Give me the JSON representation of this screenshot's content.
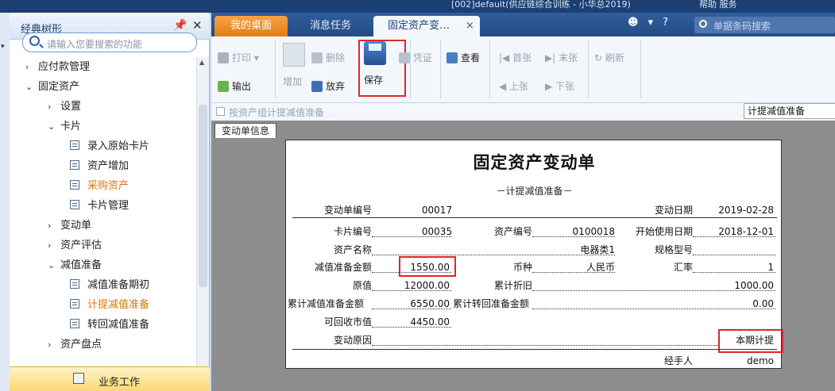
{
  "window": {
    "title_fragment": "[002]default(供应链综合训练 - 小华总2019)",
    "right_fragment": "帮助   服务"
  },
  "left_panel": {
    "title": "经典树形",
    "search_placeholder": "请输入您要搜索的功能",
    "tree": [
      {
        "label": "应付款管理",
        "chev": "›",
        "level": 1
      },
      {
        "label": "固定资产",
        "chev": "⌄",
        "level": 1
      },
      {
        "label": "设置",
        "chev": "›",
        "level": 2
      },
      {
        "label": "卡片",
        "chev": "⌄",
        "level": 2
      },
      {
        "label": "录入原始卡片",
        "level": 3
      },
      {
        "label": "资产增加",
        "level": 3
      },
      {
        "label": "采购资产",
        "level": 3,
        "highlight": true
      },
      {
        "label": "卡片管理",
        "level": 3
      },
      {
        "label": "变动单",
        "chev": "›",
        "level": 2
      },
      {
        "label": "资产评估",
        "chev": "›",
        "level": 2
      },
      {
        "label": "减值准备",
        "chev": "⌄",
        "level": 2
      },
      {
        "label": "减值准备期初",
        "level": 3
      },
      {
        "label": "计提减值准备",
        "level": 3,
        "highlight": true
      },
      {
        "label": "转回减值准备",
        "level": 3
      },
      {
        "label": "资产盘点",
        "chev": "›",
        "level": 2
      }
    ],
    "bottom_label": "业务工作"
  },
  "tabs": {
    "desk": "我的桌面",
    "msg": "消息任务",
    "active": "固定资产变…",
    "close": "×",
    "search_placeholder": "单据条码搜索"
  },
  "toolbar": {
    "print": "打印",
    "export": "输出",
    "add": "增加",
    "delete": "删除",
    "abandon": "放弃",
    "save": "保存",
    "voucher": "凭证",
    "view": "查看",
    "first": "首张",
    "last": "末张",
    "prev": "上张",
    "next": "下张",
    "refresh": "刷新"
  },
  "filter": {
    "checkbox_label": "按资产组计提减值准备",
    "combo_value": "计提减值准备"
  },
  "subtab": "变动单信息",
  "form": {
    "title": "固定资产变动单",
    "subtitle": "－计提减值准备－",
    "labels": {
      "doc_no": "变动单编号",
      "doc_date": "变动日期",
      "card_no": "卡片编号",
      "asset_no": "资产编号",
      "start_date": "开始使用日期",
      "asset_name": "资产名称",
      "spec": "规格型号",
      "impair_amount": "减值准备金额",
      "currency": "币种",
      "rate": "汇率",
      "orig_value": "原值",
      "acc_dep": "累计折旧",
      "acc_impair": "累计减值准备金额",
      "acc_reverse": "累计转回准备金额",
      "recoverable": "可回收市值",
      "reason": "变动原因",
      "handler": "经手人"
    },
    "values": {
      "doc_no": "00017",
      "doc_date": "2019-02-28",
      "card_no": "00035",
      "asset_no": "0100018",
      "start_date": "2018-12-01",
      "asset_name": "电器类1",
      "spec": "",
      "impair_amount": "1550.00",
      "currency": "人民币",
      "rate": "1",
      "orig_value": "12000.00",
      "acc_dep": "1000.00",
      "acc_impair": "6550.00",
      "acc_reverse": "0.00",
      "recoverable": "4450.00",
      "reason": "本期计提",
      "handler": "demo"
    }
  },
  "colors": {
    "accent": "#2f5e9c",
    "highlight_orange": "#d4780a",
    "annotation_red": "#e0262a"
  }
}
